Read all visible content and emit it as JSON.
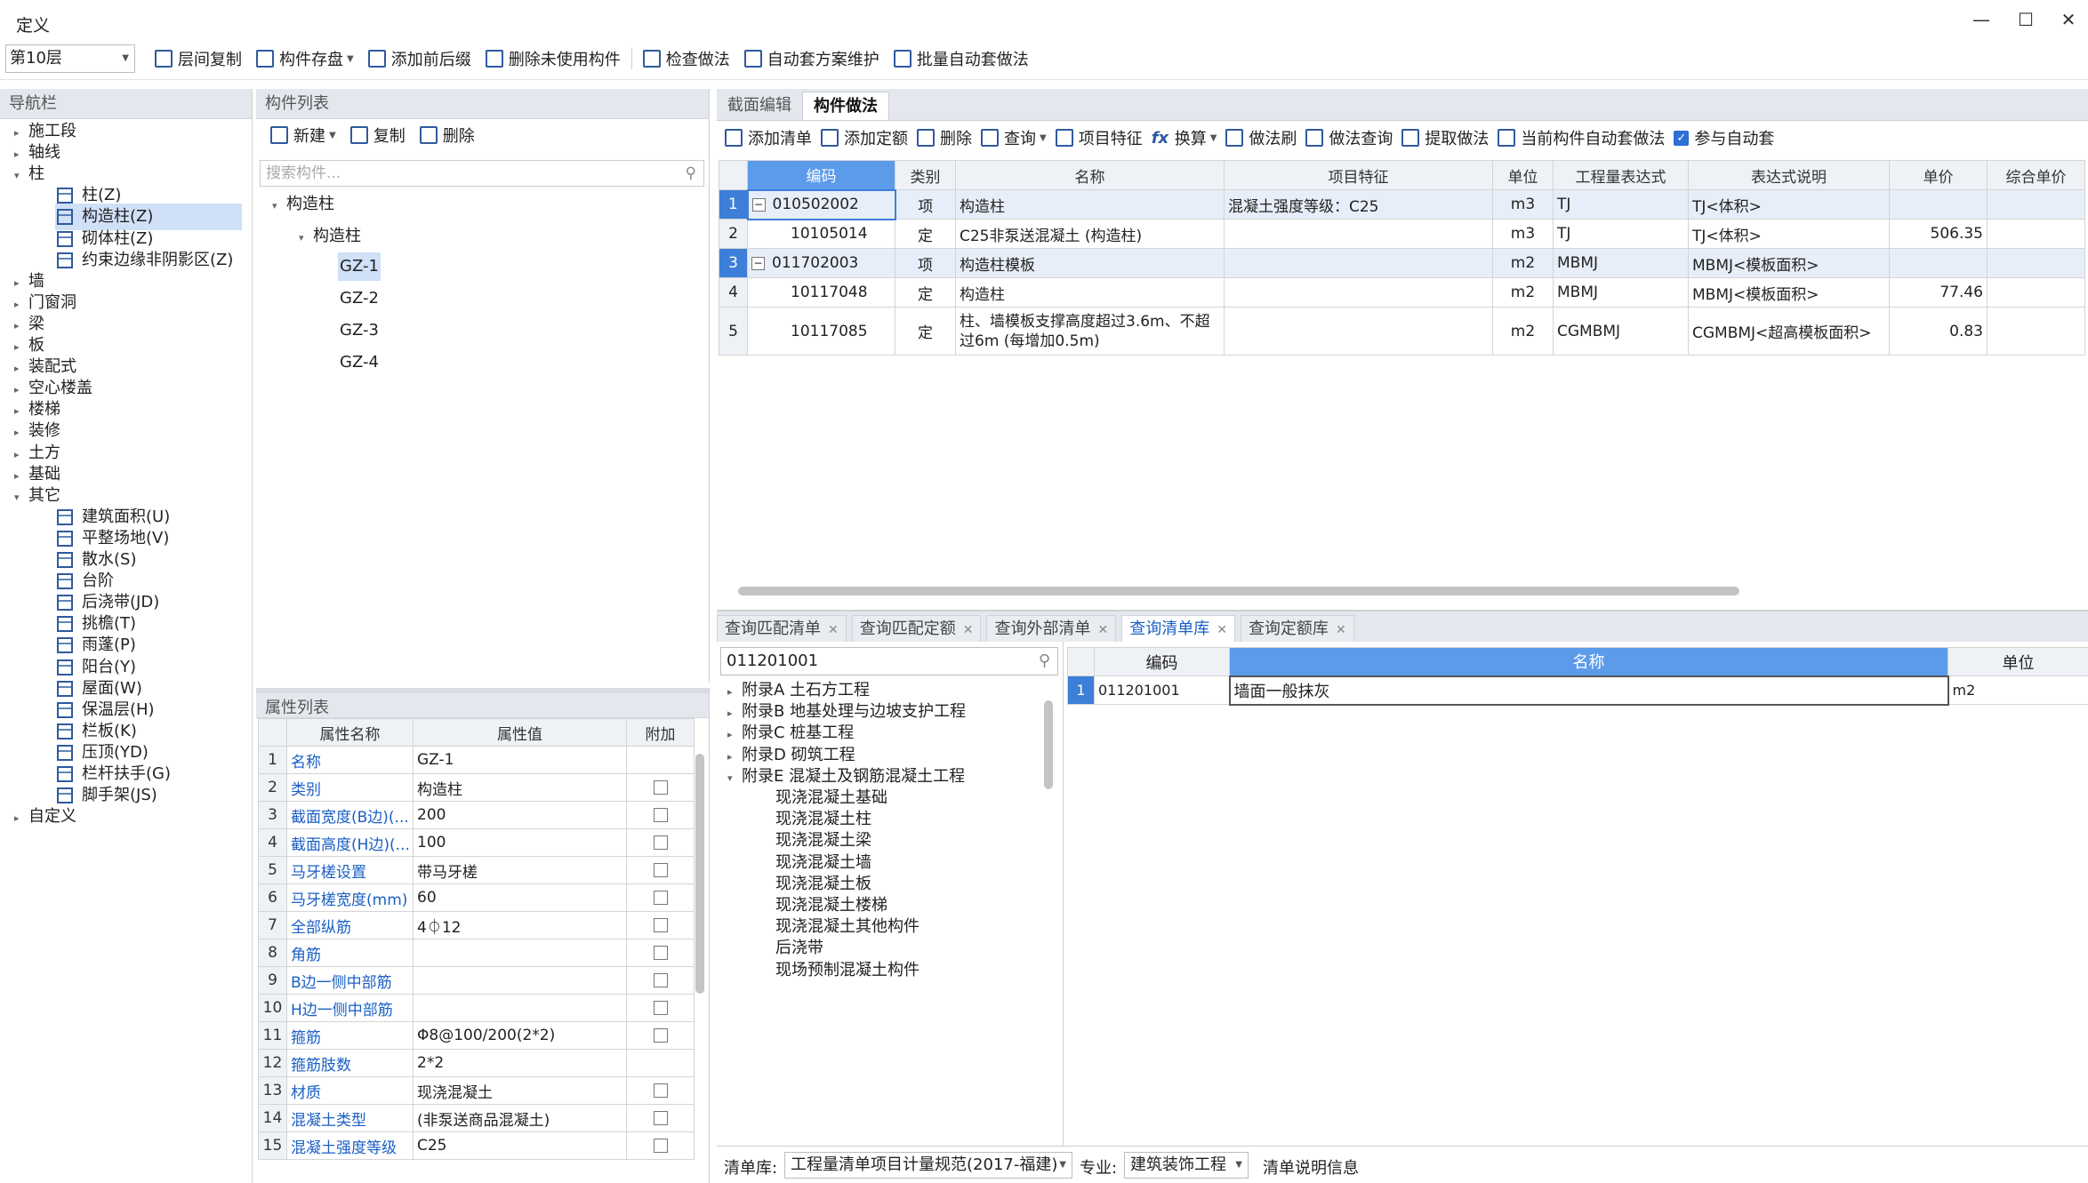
{
  "window": {
    "title": "定义",
    "controls": [
      "—",
      "☐",
      "✕"
    ]
  },
  "toolbar": {
    "floor": "第10层",
    "items": [
      "层间复制",
      "构件存盘",
      "添加前后缀",
      "删除未使用构件",
      "检查做法",
      "自动套方案维护",
      "批量自动套做法"
    ]
  },
  "nav": {
    "title": "导航栏",
    "items": [
      {
        "label": "施工段",
        "level": 0,
        "tri": "▸"
      },
      {
        "label": "轴线",
        "level": 0,
        "tri": "▸"
      },
      {
        "label": "柱",
        "level": 0,
        "tri": "▾"
      },
      {
        "label": "柱(Z)",
        "level": 1,
        "icon": "column-icon"
      },
      {
        "label": "构造柱(Z)",
        "level": 1,
        "icon": "construct-column-icon",
        "selected": true
      },
      {
        "label": "砌体柱(Z)",
        "level": 1,
        "icon": "masonry-column-icon"
      },
      {
        "label": "约束边缘非阴影区(Z)",
        "level": 1,
        "icon": "edge-zone-icon"
      },
      {
        "label": "墙",
        "level": 0,
        "tri": "▸"
      },
      {
        "label": "门窗洞",
        "level": 0,
        "tri": "▸"
      },
      {
        "label": "梁",
        "level": 0,
        "tri": "▸"
      },
      {
        "label": "板",
        "level": 0,
        "tri": "▸"
      },
      {
        "label": "装配式",
        "level": 0,
        "tri": "▸"
      },
      {
        "label": "空心楼盖",
        "level": 0,
        "tri": "▸"
      },
      {
        "label": "楼梯",
        "level": 0,
        "tri": "▸"
      },
      {
        "label": "装修",
        "level": 0,
        "tri": "▸"
      },
      {
        "label": "土方",
        "level": 0,
        "tri": "▸"
      },
      {
        "label": "基础",
        "level": 0,
        "tri": "▸"
      },
      {
        "label": "其它",
        "level": 0,
        "tri": "▾"
      },
      {
        "label": "建筑面积(U)",
        "level": 1,
        "icon": "building-area-icon"
      },
      {
        "label": "平整场地(V)",
        "level": 1,
        "icon": "site-leveling-icon"
      },
      {
        "label": "散水(S)",
        "level": 1,
        "icon": "apron-icon"
      },
      {
        "label": "台阶",
        "level": 1,
        "icon": "steps-icon"
      },
      {
        "label": "后浇带(JD)",
        "level": 1,
        "icon": "post-cast-strip-icon"
      },
      {
        "label": "挑檐(T)",
        "level": 1,
        "icon": "eave-icon"
      },
      {
        "label": "雨蓬(P)",
        "level": 1,
        "icon": "canopy-icon"
      },
      {
        "label": "阳台(Y)",
        "level": 1,
        "icon": "balcony-icon"
      },
      {
        "label": "屋面(W)",
        "level": 1,
        "icon": "roof-icon"
      },
      {
        "label": "保温层(H)",
        "level": 1,
        "icon": "insulation-icon"
      },
      {
        "label": "栏板(K)",
        "level": 1,
        "icon": "parapet-icon"
      },
      {
        "label": "压顶(YD)",
        "level": 1,
        "icon": "coping-icon"
      },
      {
        "label": "栏杆扶手(G)",
        "level": 1,
        "icon": "railing-icon"
      },
      {
        "label": "脚手架(JS)",
        "level": 1,
        "icon": "scaffold-icon"
      },
      {
        "label": "自定义",
        "level": 0,
        "tri": "▸"
      }
    ]
  },
  "components": {
    "title": "构件列表",
    "new_label": "新建",
    "copy_label": "复制",
    "delete_label": "删除",
    "search_placeholder": "搜索构件...",
    "tree_root": "构造柱",
    "tree_group": "构造柱",
    "items": [
      "GZ-1",
      "GZ-2",
      "GZ-3",
      "GZ-4"
    ]
  },
  "properties": {
    "title": "属性列表",
    "headers": [
      "属性名称",
      "属性值",
      "附加"
    ],
    "rows": [
      {
        "n": "1",
        "name": "名称",
        "value": "GZ-1",
        "cb": false
      },
      {
        "n": "2",
        "name": "类别",
        "value": "构造柱",
        "cb": true
      },
      {
        "n": "3",
        "name": "截面宽度(B边)(...",
        "value": "200",
        "cb": true
      },
      {
        "n": "4",
        "name": "截面高度(H边)(...",
        "value": "100",
        "cb": true
      },
      {
        "n": "5",
        "name": "马牙槎设置",
        "value": "带马牙槎",
        "cb": true
      },
      {
        "n": "6",
        "name": "马牙槎宽度(mm)",
        "value": "60",
        "cb": true
      },
      {
        "n": "7",
        "name": "全部纵筋",
        "value": "4⏀12",
        "cb": true
      },
      {
        "n": "8",
        "name": "角筋",
        "value": "",
        "cb": true
      },
      {
        "n": "9",
        "name": "B边一侧中部筋",
        "value": "",
        "cb": true
      },
      {
        "n": "10",
        "name": "H边一侧中部筋",
        "value": "",
        "cb": true
      },
      {
        "n": "11",
        "name": "箍筋",
        "value": "Φ8@100/200(2*2)",
        "cb": true
      },
      {
        "n": "12",
        "name": "箍筋肢数",
        "value": "2*2",
        "cb": false
      },
      {
        "n": "13",
        "name": "材质",
        "value": "现浇混凝土",
        "cb": true
      },
      {
        "n": "14",
        "name": "混凝土类型",
        "value": "(非泵送商品混凝土)",
        "cb": true
      },
      {
        "n": "15",
        "name": "混凝土强度等级",
        "value": "C25",
        "cb": true
      }
    ]
  },
  "method": {
    "tabs": [
      "截面编辑",
      "构件做法"
    ],
    "active_tab": 1,
    "toolbar": [
      "添加清单",
      "添加定额",
      "删除",
      "查询",
      "项目特征",
      "换算",
      "做法刷",
      "做法查询",
      "提取做法",
      "当前构件自动套做法"
    ],
    "auto_label": "参与自动套",
    "headers": [
      "编码",
      "类别",
      "名称",
      "项目特征",
      "单位",
      "工程量表达式",
      "表达式说明",
      "单价",
      "综合单价"
    ],
    "rows": [
      {
        "n": "1",
        "code": "010502002",
        "type": "项",
        "name": "构造柱",
        "feature": "混凝土强度等级：C25",
        "unit": "m3",
        "expr": "TJ",
        "desc": "TJ<体积>",
        "price": "",
        "comp": "",
        "minus": true
      },
      {
        "n": "2",
        "code": "10105014",
        "type": "定",
        "name": "C25非泵送混凝土 (构造柱)",
        "feature": "",
        "unit": "m3",
        "expr": "TJ",
        "desc": "TJ<体积>",
        "price": "506.35",
        "comp": ""
      },
      {
        "n": "3",
        "code": "011702003",
        "type": "项",
        "name": "构造柱模板",
        "feature": "",
        "unit": "m2",
        "expr": "MBMJ",
        "desc": "MBMJ<模板面积>",
        "price": "",
        "comp": "",
        "minus": true
      },
      {
        "n": "4",
        "code": "10117048",
        "type": "定",
        "name": "构造柱",
        "feature": "",
        "unit": "m2",
        "expr": "MBMJ",
        "desc": "MBMJ<模板面积>",
        "price": "77.46",
        "comp": ""
      },
      {
        "n": "5",
        "code": "10117085",
        "type": "定",
        "name": "柱、墙模板支撑高度超过3.6m、不超",
        "name2": "过6m (每增加0.5m)",
        "feature": "",
        "unit": "m2",
        "expr": "CGMBMJ",
        "desc": "CGMBMJ<超高模板面积>",
        "price": "0.83",
        "comp": ""
      }
    ]
  },
  "query": {
    "tabs": [
      "查询匹配清单",
      "查询匹配定额",
      "查询外部清单",
      "查询清单库",
      "查询定额库"
    ],
    "active_tab": 3,
    "search_value": "011201001",
    "tree": [
      {
        "label": "附录A 土石方工程",
        "tri": "▸",
        "level": 0
      },
      {
        "label": "附录B 地基处理与边坡支护工程",
        "tri": "▸",
        "level": 0
      },
      {
        "label": "附录C 桩基工程",
        "tri": "▸",
        "level": 0
      },
      {
        "label": "附录D 砌筑工程",
        "tri": "▸",
        "level": 0
      },
      {
        "label": "附录E 混凝土及钢筋混凝土工程",
        "tri": "▾",
        "level": 0
      },
      {
        "label": "现浇混凝土基础",
        "level": 1
      },
      {
        "label": "现浇混凝土柱",
        "level": 1
      },
      {
        "label": "现浇混凝土梁",
        "level": 1
      },
      {
        "label": "现浇混凝土墙",
        "level": 1
      },
      {
        "label": "现浇混凝土板",
        "level": 1
      },
      {
        "label": "现浇混凝土楼梯",
        "level": 1
      },
      {
        "label": "现浇混凝土其他构件",
        "level": 1
      },
      {
        "label": "后浇带",
        "level": 1
      },
      {
        "label": "现场预制混凝土构件",
        "level": 1
      }
    ],
    "result_headers": [
      "编码",
      "名称",
      "单位"
    ],
    "result_rows": [
      {
        "n": "1",
        "code": "011201001",
        "name": "墙面一般抹灰",
        "unit": "m2"
      }
    ],
    "lib_label": "清单库:",
    "lib_value": "工程量清单项目计量规范(2017-福建)",
    "spec_label": "专业:",
    "spec_value": "建筑装饰工程",
    "info_label": "清单说明信息"
  },
  "colors": {
    "accent": "#3d7fd8",
    "header_bg": "#e4e8ee",
    "selected": "#cfe0f7",
    "link": "#1a5fc4"
  }
}
